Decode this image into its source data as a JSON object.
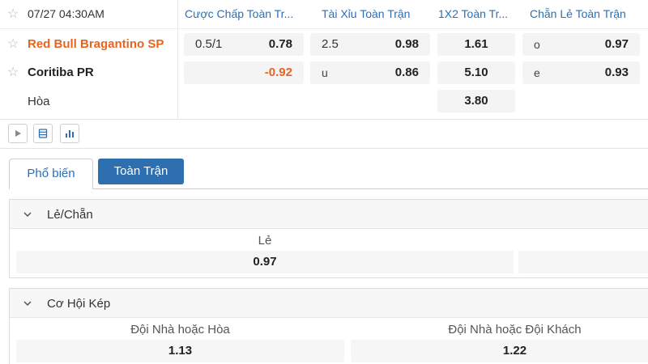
{
  "match": {
    "datetime": "07/27 04:30AM",
    "columns": [
      "Cược Chấp Toàn Tr...",
      "Tài Xỉu Toàn Trận",
      "1X2 Toàn Tr...",
      "Chẵn Lẻ Toàn Trận"
    ],
    "home": {
      "name": "Red Bull Bragantino SP",
      "handicap_line": "0.5/1",
      "handicap_odds": "0.78",
      "ou_line": "2.5",
      "ou_odds": "0.98",
      "x12": "1.61",
      "oe_label": "o",
      "oe_odds": "0.97"
    },
    "away": {
      "name": "Coritiba PR",
      "handicap_odds": "-0.92",
      "ou_line": "u",
      "ou_odds": "0.86",
      "x12": "5.10",
      "oe_label": "e",
      "oe_odds": "0.93"
    },
    "draw": {
      "name": "Hòa",
      "x12": "3.80"
    }
  },
  "tabs": {
    "popular": "Phổ biến",
    "full_match": "Toàn Trận"
  },
  "markets": {
    "odd_even": {
      "title": "Lẻ/Chẵn",
      "label": "Lẻ",
      "value": "0.97"
    },
    "double_chance": {
      "title": "Cơ Hội Kép",
      "options": [
        {
          "label": "Đội Nhà hoặc Hòa",
          "value": "1.13"
        },
        {
          "label": "Đội Nhà hoặc Đội Khách",
          "value": "1.22"
        }
      ]
    }
  },
  "colors": {
    "accent": "#2a6fb8",
    "home_team": "#e8641e",
    "negative": "#e8641e",
    "tab_active_bg": "#2e6fb0"
  },
  "icons": {
    "favorite": "star-icon",
    "play": "play-icon",
    "list": "list-icon",
    "stats": "bar-chart-icon",
    "collapse": "chevron-down-icon"
  }
}
